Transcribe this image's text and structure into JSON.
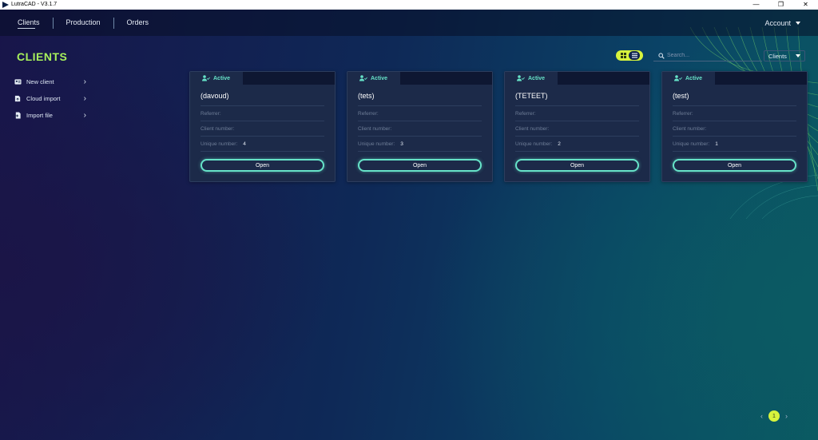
{
  "window": {
    "title": "LutraCAD - V3.1.7",
    "controls": [
      "—",
      "❐",
      "✕"
    ]
  },
  "nav": {
    "links": [
      "Clients",
      "Production",
      "Orders"
    ],
    "account_label": "Account"
  },
  "page": {
    "title": "CLIENTS"
  },
  "sidebar": {
    "items": [
      {
        "label": "New client",
        "icon": "id-card-icon"
      },
      {
        "label": "Cloud import",
        "icon": "cloud-upload-icon"
      },
      {
        "label": "Import file",
        "icon": "file-import-icon"
      }
    ]
  },
  "toolbar": {
    "search_placeholder": "Search...",
    "scope_value": "Clients",
    "view_mode": "grid"
  },
  "field_labels": {
    "referrer": "Referrer:",
    "client_number": "Client number:",
    "unique_number": "Unique number:"
  },
  "cards": [
    {
      "status": "Active",
      "name": "(davoud)",
      "referrer": "",
      "client_number": "",
      "unique_number": "4",
      "open_label": "Open"
    },
    {
      "status": "Active",
      "name": "(tets)",
      "referrer": "",
      "client_number": "",
      "unique_number": "3",
      "open_label": "Open"
    },
    {
      "status": "Active",
      "name": "(TETEET)",
      "referrer": "",
      "client_number": "",
      "unique_number": "2",
      "open_label": "Open"
    },
    {
      "status": "Active",
      "name": "(test)",
      "referrer": "",
      "client_number": "",
      "unique_number": "1",
      "open_label": "Open"
    }
  ],
  "pagination": {
    "prev": "‹",
    "current": "1",
    "next": "›"
  },
  "colors": {
    "accent_lime": "#d7f43d",
    "accent_teal": "#66e3c8",
    "title_green": "#a7f05c"
  }
}
